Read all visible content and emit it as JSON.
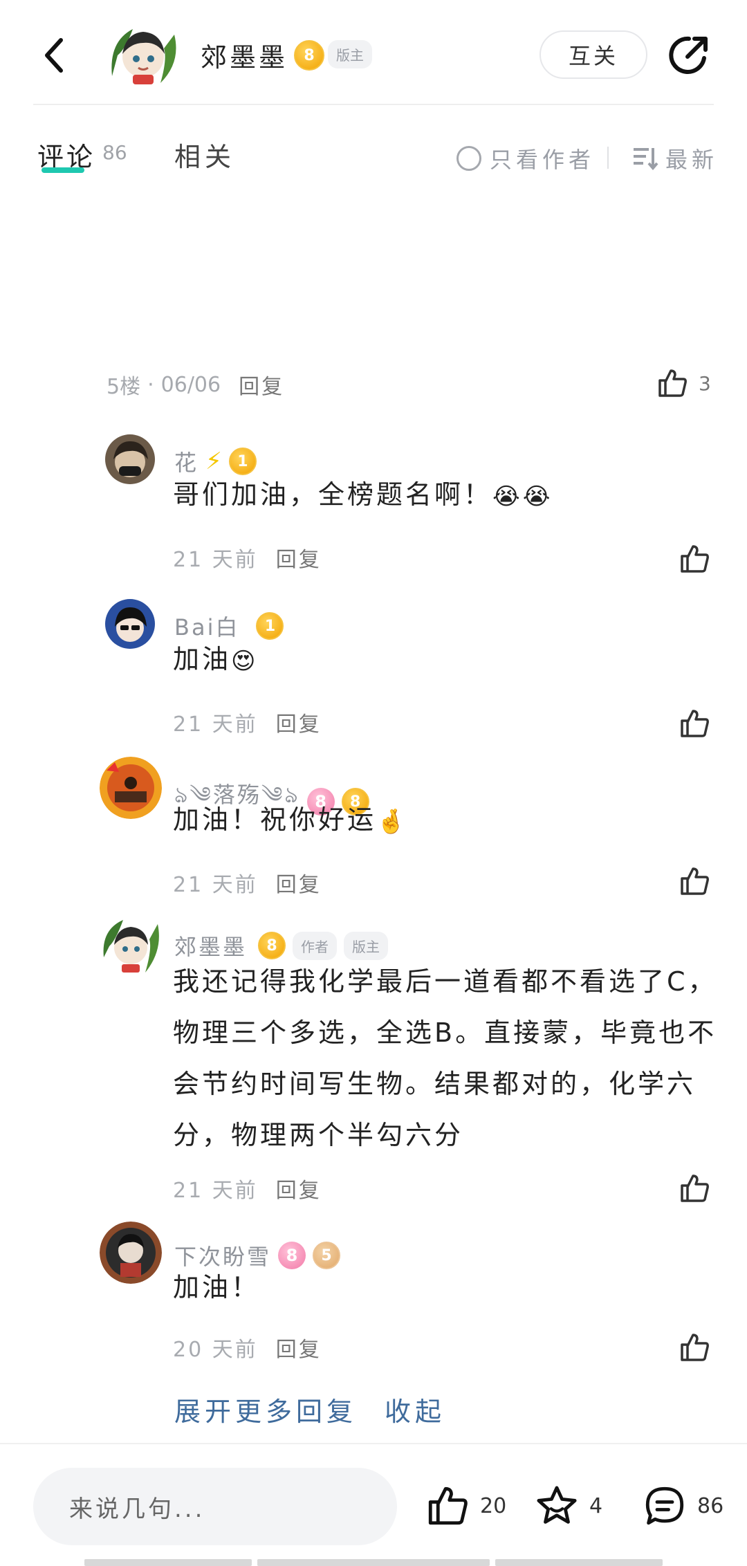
{
  "header": {
    "author_name": "郊墨墨",
    "level": "8",
    "role": "版主",
    "follow_label": "互关"
  },
  "tabs": {
    "comments_label": "评论",
    "comments_count": "86",
    "related_label": "相关",
    "author_only_label": "只看作者",
    "sort_label": "最新"
  },
  "floor": {
    "floor_text": "5楼",
    "date": "06/06",
    "reply_label": "回复",
    "likes": "3"
  },
  "replies": [
    {
      "name": "花",
      "level": "1",
      "text": "哥们加油，全榜题名啊！",
      "time": "21 天前",
      "reply_label": "回复"
    },
    {
      "name": "Bai白",
      "level": "1",
      "text": "加油",
      "time": "21 天前",
      "reply_label": "回复"
    },
    {
      "name": "ঌ༄落殇༄ঌ",
      "level": "8",
      "pink_level": "8",
      "text": "加油！祝你好运",
      "time": "21 天前",
      "reply_label": "回复"
    },
    {
      "name": "郊墨墨",
      "level": "8",
      "tag_author": "作者",
      "tag_moderator": "版主",
      "text": "我还记得我化学最后一道看都不看选了C，物理三个多选，全选B。直接蒙，毕竟也不会节约时间写生物。结果都对的，化学六分，物理两个半勾六分",
      "time": "21 天前",
      "reply_label": "回复"
    },
    {
      "name": "下次盼雪",
      "level": "5",
      "pink_level": "8",
      "text": "加油！",
      "time": "20 天前",
      "reply_label": "回复"
    }
  ],
  "expand": {
    "more_label": "展开更多回复",
    "collapse_label": "收起"
  },
  "bottom_bar": {
    "input_placeholder": "来说几句...",
    "likes": "20",
    "favorites": "4",
    "comments": "86"
  },
  "colors": {
    "accent": "#1ec8b0",
    "link": "#3f6b9c",
    "level_gold": "#f2a300",
    "level_pink": "#f27aa8"
  }
}
